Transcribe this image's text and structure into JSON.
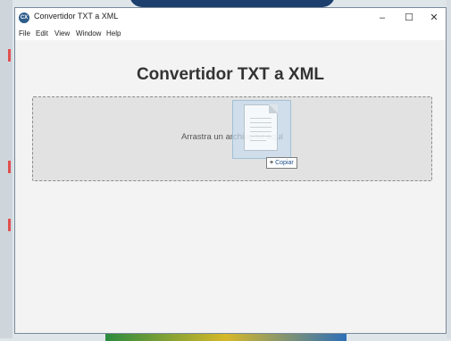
{
  "window": {
    "title": "Convertidor TXT a XML",
    "icon": "app-icon",
    "controls": {
      "minimize": "–",
      "maximize": "☐",
      "close": "✕"
    }
  },
  "menu": [
    "File",
    "Edit",
    "View",
    "Window",
    "Help"
  ],
  "main": {
    "heading": "Convertidor TXT a XML",
    "drop_zone_text": "Arrastra un archivo txt aquí"
  },
  "drag": {
    "icon": "file-icon",
    "copy_label": "Copiar",
    "copy_symbol": "+"
  },
  "colors": {
    "window_bg": "#f3f3f3",
    "drop_zone_bg": "#e2e2e2",
    "heading_color": "#333333"
  }
}
